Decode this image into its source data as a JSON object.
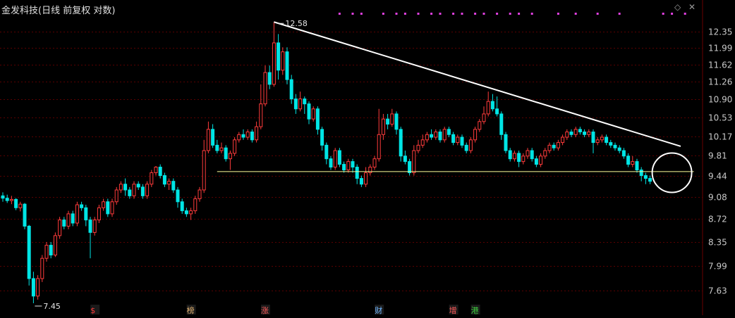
{
  "title": "金发科技(日线 前复权 对数)",
  "window_controls": {
    "pin_icon": "◇",
    "close_icon": "✕"
  },
  "colors": {
    "up": "#ff3b3b",
    "down": "#00e5e5",
    "trendline": "#ffffff",
    "support": "#ffff99",
    "grid": "#5a0000",
    "marker": "#e040e0"
  },
  "chart_data": {
    "type": "candlestick",
    "y_scale": "log",
    "ylim": [
      7.45,
      12.7
    ],
    "yticks": [
      "12.35",
      "11.99",
      "11.62",
      "11.26",
      "10.90",
      "10.53",
      "10.17",
      "9.81",
      "9.44",
      "9.08",
      "8.72",
      "8.35",
      "7.99",
      "7.63"
    ],
    "high_annotation": "12.58",
    "low_annotation": "7.45",
    "candles": [
      [
        9.1,
        9.06,
        9.16,
        9.0
      ],
      [
        9.06,
        9.02,
        9.12,
        8.98
      ],
      [
        9.02,
        9.04,
        9.1,
        8.96
      ],
      [
        9.04,
        8.9,
        9.06,
        8.86
      ],
      [
        8.9,
        8.96,
        9.0,
        8.84
      ],
      [
        8.96,
        8.6,
        8.98,
        8.55
      ],
      [
        8.6,
        7.8,
        8.62,
        7.7
      ],
      [
        7.8,
        7.55,
        7.9,
        7.45
      ],
      [
        7.55,
        7.8,
        7.85,
        7.5
      ],
      [
        7.8,
        8.1,
        8.15,
        7.75
      ],
      [
        8.1,
        8.3,
        8.35,
        8.05
      ],
      [
        8.3,
        8.15,
        8.35,
        8.1
      ],
      [
        8.15,
        8.45,
        8.5,
        8.12
      ],
      [
        8.45,
        8.7,
        8.75,
        8.4
      ],
      [
        8.7,
        8.6,
        8.75,
        8.55
      ],
      [
        8.6,
        8.8,
        8.85,
        8.55
      ],
      [
        8.8,
        8.65,
        8.85,
        8.6
      ],
      [
        8.65,
        8.95,
        9.0,
        8.6
      ],
      [
        8.95,
        8.9,
        9.0,
        8.85
      ],
      [
        8.9,
        8.7,
        8.95,
        8.6
      ],
      [
        8.7,
        8.5,
        8.75,
        8.1
      ],
      [
        8.5,
        8.7,
        8.75,
        8.45
      ],
      [
        8.7,
        8.9,
        8.95,
        8.65
      ],
      [
        8.9,
        9.0,
        9.05,
        8.85
      ],
      [
        9.0,
        8.8,
        9.05,
        8.75
      ],
      [
        8.8,
        9.0,
        9.05,
        8.75
      ],
      [
        9.0,
        9.2,
        9.25,
        8.95
      ],
      [
        9.2,
        9.3,
        9.35,
        9.15
      ],
      [
        9.3,
        9.2,
        9.4,
        9.1
      ],
      [
        9.2,
        9.1,
        9.25,
        9.05
      ],
      [
        9.1,
        9.3,
        9.35,
        9.05
      ],
      [
        9.3,
        9.25,
        9.35,
        9.2
      ],
      [
        9.25,
        9.1,
        9.3,
        9.05
      ],
      [
        9.1,
        9.3,
        9.35,
        9.05
      ],
      [
        9.3,
        9.5,
        9.55,
        9.25
      ],
      [
        9.5,
        9.6,
        9.62,
        9.45
      ],
      [
        9.6,
        9.45,
        9.65,
        9.4
      ],
      [
        9.45,
        9.3,
        9.5,
        9.25
      ],
      [
        9.3,
        9.35,
        9.4,
        9.2
      ],
      [
        9.35,
        9.2,
        9.4,
        9.15
      ],
      [
        9.2,
        9.0,
        9.25,
        8.9
      ],
      [
        9.0,
        8.85,
        9.05,
        8.8
      ],
      [
        8.85,
        8.8,
        8.9,
        8.75
      ],
      [
        8.8,
        8.85,
        8.9,
        8.7
      ],
      [
        8.85,
        9.05,
        9.1,
        8.8
      ],
      [
        9.05,
        9.2,
        9.25,
        9.0
      ],
      [
        9.2,
        9.9,
        10.1,
        9.15
      ],
      [
        9.9,
        10.3,
        10.45,
        9.85
      ],
      [
        10.3,
        10.0,
        10.4,
        9.95
      ],
      [
        10.0,
        9.9,
        10.1,
        9.85
      ],
      [
        9.9,
        9.95,
        10.05,
        9.85
      ],
      [
        9.95,
        9.75,
        10.0,
        9.7
      ],
      [
        9.75,
        9.85,
        9.9,
        9.55
      ],
      [
        9.85,
        10.1,
        10.15,
        9.8
      ],
      [
        10.1,
        10.2,
        10.25,
        10.05
      ],
      [
        10.2,
        10.15,
        10.3,
        10.1
      ],
      [
        10.15,
        10.25,
        10.3,
        10.1
      ],
      [
        10.25,
        10.1,
        10.3,
        10.05
      ],
      [
        10.1,
        10.35,
        10.45,
        10.05
      ],
      [
        10.35,
        10.8,
        11.2,
        10.3
      ],
      [
        10.8,
        11.45,
        11.6,
        10.75
      ],
      [
        11.45,
        11.2,
        11.6,
        11.1
      ],
      [
        11.2,
        12.1,
        12.58,
        11.15
      ],
      [
        12.1,
        11.5,
        12.3,
        11.3
      ],
      [
        11.5,
        11.9,
        12.0,
        11.4
      ],
      [
        11.9,
        11.3,
        12.0,
        11.2
      ],
      [
        11.3,
        10.9,
        11.4,
        10.8
      ],
      [
        10.9,
        10.7,
        11.0,
        10.6
      ],
      [
        10.7,
        10.9,
        11.05,
        10.65
      ],
      [
        10.9,
        10.8,
        10.95,
        10.6
      ],
      [
        10.8,
        10.5,
        10.85,
        10.4
      ],
      [
        10.5,
        10.7,
        10.75,
        10.45
      ],
      [
        10.7,
        10.3,
        10.75,
        10.2
      ],
      [
        10.3,
        10.0,
        10.35,
        9.9
      ],
      [
        10.0,
        9.75,
        10.05,
        9.65
      ],
      [
        9.75,
        9.6,
        9.8,
        9.55
      ],
      [
        9.6,
        9.9,
        9.95,
        9.55
      ],
      [
        9.9,
        9.65,
        9.95,
        9.6
      ],
      [
        9.65,
        9.55,
        9.7,
        9.5
      ],
      [
        9.55,
        9.7,
        9.75,
        9.5
      ],
      [
        9.7,
        9.6,
        9.75,
        9.5
      ],
      [
        9.6,
        9.4,
        9.65,
        9.3
      ],
      [
        9.4,
        9.3,
        9.45,
        9.25
      ],
      [
        9.3,
        9.5,
        9.6,
        9.25
      ],
      [
        9.5,
        9.6,
        9.65,
        9.45
      ],
      [
        9.6,
        9.75,
        9.8,
        9.55
      ],
      [
        9.75,
        10.2,
        10.7,
        9.7
      ],
      [
        10.2,
        10.5,
        10.6,
        10.1
      ],
      [
        10.5,
        10.4,
        10.6,
        10.3
      ],
      [
        10.4,
        10.6,
        10.7,
        10.35
      ],
      [
        10.6,
        10.3,
        10.65,
        10.2
      ],
      [
        10.3,
        9.8,
        10.35,
        9.7
      ],
      [
        9.8,
        9.7,
        9.9,
        9.65
      ],
      [
        9.7,
        9.5,
        9.75,
        9.45
      ],
      [
        9.5,
        9.9,
        10.0,
        9.45
      ],
      [
        9.9,
        10.0,
        10.1,
        9.85
      ],
      [
        10.0,
        10.1,
        10.2,
        9.95
      ],
      [
        10.1,
        10.2,
        10.25,
        10.05
      ],
      [
        10.2,
        10.15,
        10.3,
        10.1
      ],
      [
        10.15,
        10.25,
        10.3,
        10.1
      ],
      [
        10.25,
        10.1,
        10.3,
        10.05
      ],
      [
        10.1,
        10.3,
        10.35,
        10.05
      ],
      [
        10.3,
        10.2,
        10.35,
        10.15
      ],
      [
        10.2,
        10.05,
        10.25,
        10.0
      ],
      [
        10.05,
        10.15,
        10.2,
        10.0
      ],
      [
        10.15,
        10.0,
        10.2,
        9.95
      ],
      [
        10.0,
        9.9,
        10.05,
        9.85
      ],
      [
        9.9,
        10.1,
        10.15,
        9.85
      ],
      [
        10.1,
        10.3,
        10.35,
        10.05
      ],
      [
        10.3,
        10.45,
        10.5,
        10.25
      ],
      [
        10.45,
        10.6,
        10.75,
        10.4
      ],
      [
        10.6,
        10.85,
        11.05,
        10.55
      ],
      [
        10.85,
        10.7,
        11.0,
        10.65
      ],
      [
        10.7,
        10.6,
        10.95,
        10.55
      ],
      [
        10.6,
        10.2,
        10.65,
        10.1
      ],
      [
        10.2,
        9.9,
        10.25,
        9.85
      ],
      [
        9.9,
        9.75,
        9.95,
        9.7
      ],
      [
        9.75,
        9.85,
        9.9,
        9.7
      ],
      [
        9.85,
        9.7,
        9.9,
        9.6
      ],
      [
        9.7,
        9.8,
        9.85,
        9.65
      ],
      [
        9.8,
        9.9,
        9.95,
        9.75
      ],
      [
        9.9,
        9.75,
        9.95,
        9.7
      ],
      [
        9.75,
        9.65,
        9.8,
        9.6
      ],
      [
        9.65,
        9.8,
        9.85,
        9.6
      ],
      [
        9.8,
        9.9,
        9.95,
        9.75
      ],
      [
        9.9,
        10.0,
        10.05,
        9.85
      ],
      [
        10.0,
        9.95,
        10.05,
        9.9
      ],
      [
        9.95,
        10.05,
        10.1,
        9.9
      ],
      [
        10.05,
        10.15,
        10.2,
        10.0
      ],
      [
        10.15,
        10.25,
        10.3,
        10.1
      ],
      [
        10.25,
        10.2,
        10.3,
        10.15
      ],
      [
        10.2,
        10.3,
        10.35,
        10.15
      ],
      [
        10.3,
        10.25,
        10.35,
        10.2
      ],
      [
        10.25,
        10.2,
        10.3,
        10.15
      ],
      [
        10.2,
        10.25,
        10.3,
        10.15
      ],
      [
        10.25,
        10.05,
        10.3,
        9.85
      ],
      [
        10.05,
        10.1,
        10.15,
        10.0
      ],
      [
        10.1,
        10.15,
        10.2,
        10.05
      ],
      [
        10.15,
        10.05,
        10.2,
        10.0
      ],
      [
        10.05,
        10.0,
        10.1,
        9.95
      ],
      [
        10.0,
        9.95,
        10.05,
        9.9
      ],
      [
        9.95,
        9.9,
        10.0,
        9.85
      ],
      [
        9.9,
        9.8,
        9.95,
        9.75
      ],
      [
        9.8,
        9.65,
        9.85,
        9.6
      ],
      [
        9.65,
        9.7,
        9.8,
        9.6
      ],
      [
        9.7,
        9.55,
        9.75,
        9.5
      ],
      [
        9.55,
        9.45,
        9.6,
        9.35
      ],
      [
        9.45,
        9.4,
        9.5,
        9.3
      ],
      [
        9.4,
        9.35,
        9.45,
        9.3
      ]
    ],
    "trendline": {
      "from": [
        62,
        12.58
      ],
      "to": [
        155,
        9.98
      ]
    },
    "support_line": {
      "from": [
        49,
        9.52
      ],
      "to": [
        158,
        9.52
      ]
    },
    "highlight_circle": {
      "index": 153,
      "price": 9.5
    },
    "top_markers": [
      77,
      80,
      82,
      87,
      90,
      92,
      95,
      98,
      100,
      103,
      105,
      108,
      110,
      113,
      116,
      118,
      121,
      127,
      131,
      136,
      141,
      151,
      153,
      156
    ],
    "event_labels": [
      {
        "index": 21,
        "text": "$",
        "color": "#ff3b3b"
      },
      {
        "index": 43,
        "text": "榜",
        "color": "#e0b070"
      },
      {
        "index": 60,
        "text": "涨",
        "color": "#ff5a5a"
      },
      {
        "index": 86,
        "text": "财",
        "color": "#6fb6ff"
      },
      {
        "index": 103,
        "text": "增",
        "color": "#ff5a5a"
      },
      {
        "index": 108,
        "text": "港",
        "color": "#3ecf3e"
      }
    ]
  }
}
